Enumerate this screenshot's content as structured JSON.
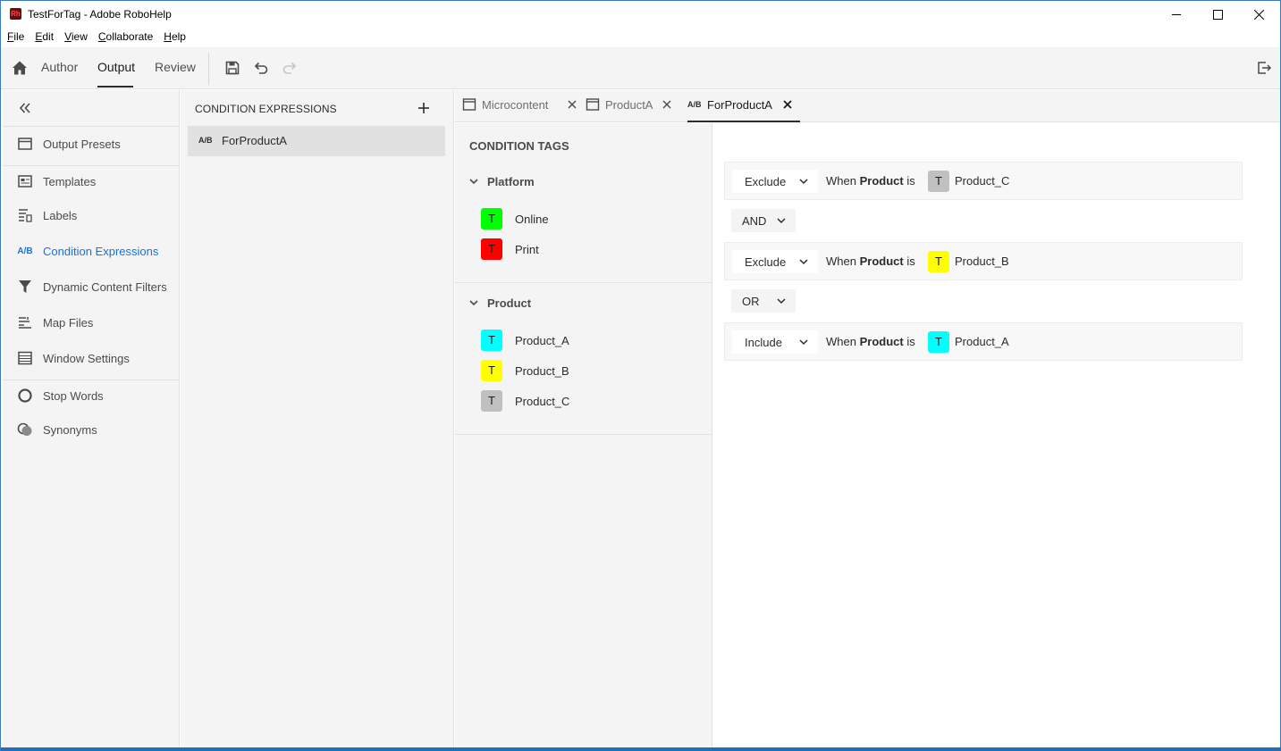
{
  "window": {
    "title": "TestForTag - Adobe RoboHelp",
    "logo_text": "Rh"
  },
  "menu": [
    {
      "underline": "F",
      "rest": "ile"
    },
    {
      "underline": "E",
      "rest": "dit"
    },
    {
      "underline": "V",
      "rest": "iew"
    },
    {
      "underline": "C",
      "rest": "ollaborate"
    },
    {
      "underline": "H",
      "rest": "elp"
    }
  ],
  "toolbar": {
    "tabs": [
      "Author",
      "Output",
      "Review"
    ],
    "active_tab": "Output"
  },
  "leftnav": {
    "items": [
      {
        "label": "Output Presets",
        "icon": "output-presets-icon"
      },
      {
        "label": "Templates",
        "icon": "templates-icon"
      },
      {
        "label": "Labels",
        "icon": "labels-icon"
      },
      {
        "label": "Condition Expressions",
        "icon": "ab-icon",
        "icon_text": "A/B",
        "active": true
      },
      {
        "label": "Dynamic Content Filters",
        "icon": "filter-icon"
      },
      {
        "label": "Map Files",
        "icon": "map-files-icon"
      },
      {
        "label": "Window Settings",
        "icon": "window-settings-icon"
      },
      {
        "label": "Stop Words",
        "icon": "stop-words-icon"
      },
      {
        "label": "Synonyms",
        "icon": "synonyms-icon"
      }
    ]
  },
  "expressions_panel": {
    "title": "CONDITION EXPRESSIONS",
    "items": [
      {
        "prefix": "A/B",
        "label": "ForProductA"
      }
    ]
  },
  "doc_tabs": [
    {
      "label": "Microcontent",
      "active": false
    },
    {
      "label": "ProductA",
      "active": false
    },
    {
      "prefix": "A/B",
      "label": "ForProductA",
      "active": true
    }
  ],
  "condition_tags": {
    "title": "CONDITION TAGS",
    "groups": [
      {
        "name": "Platform",
        "tags": [
          {
            "name": "Online",
            "letter": "T",
            "color": "#00ff00"
          },
          {
            "name": "Print",
            "letter": "T",
            "color": "#ff0000"
          }
        ]
      },
      {
        "name": "Product",
        "tags": [
          {
            "name": "Product_A",
            "letter": "T",
            "color": "#00ffff"
          },
          {
            "name": "Product_B",
            "letter": "T",
            "color": "#ffff00"
          },
          {
            "name": "Product_C",
            "letter": "T",
            "color": "#c0c0c0"
          }
        ]
      }
    ]
  },
  "expression": {
    "rules": [
      {
        "action": "Exclude",
        "when": "When",
        "field": "Product",
        "is": "is",
        "tag_letter": "T",
        "tag": "Product_C",
        "color": "#c0c0c0"
      },
      {
        "action": "Exclude",
        "when": "When",
        "field": "Product",
        "is": "is",
        "tag_letter": "T",
        "tag": "Product_B",
        "color": "#ffff00"
      },
      {
        "action": "Include",
        "when": "When",
        "field": "Product",
        "is": "is",
        "tag_letter": "T",
        "tag": "Product_A",
        "color": "#00ffff"
      }
    ],
    "operators": [
      "AND",
      "OR"
    ]
  }
}
